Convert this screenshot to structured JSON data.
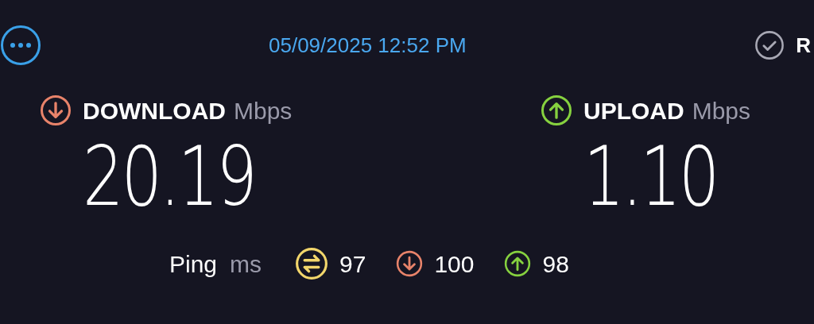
{
  "header": {
    "date_time": "05/09/2025 12:52 PM",
    "right_label": "R"
  },
  "metrics": [
    {
      "kind": "download",
      "label": "DOWNLOAD",
      "unit": "Mbps",
      "value": "20.19"
    },
    {
      "kind": "upload",
      "label": "UPLOAD",
      "unit": "Mbps",
      "value": "1.10"
    }
  ],
  "ping": {
    "label": "Ping",
    "unit": "ms",
    "readings": [
      {
        "kind": "idle",
        "value": "97"
      },
      {
        "kind": "download",
        "value": "100"
      },
      {
        "kind": "upload",
        "value": "98"
      }
    ]
  }
}
